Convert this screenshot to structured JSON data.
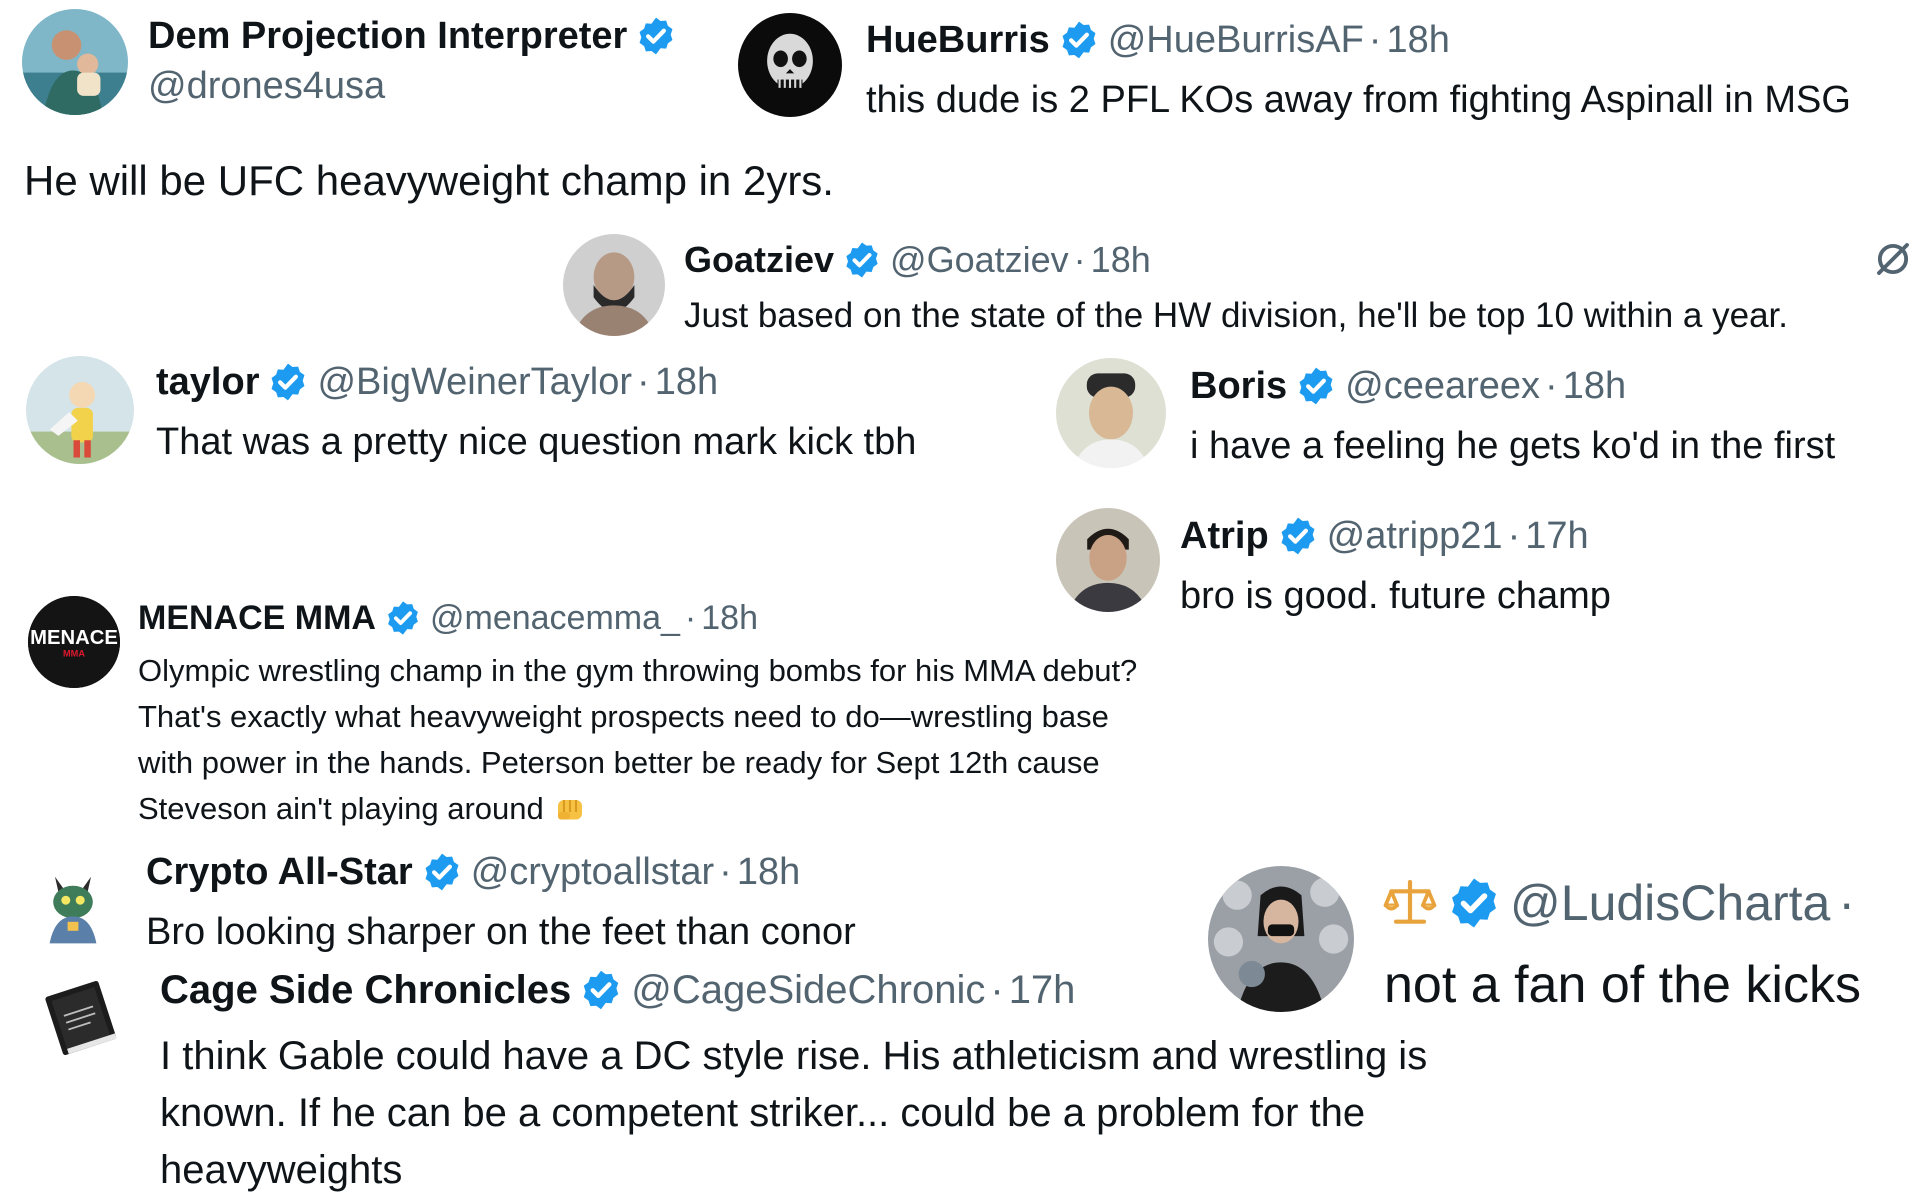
{
  "colors": {
    "verified_badge": "#1d9bf0",
    "text_primary": "#0f1419",
    "text_secondary": "#536471",
    "background": "#ffffff"
  },
  "posts": [
    {
      "id": "p1",
      "display_name": "Dem Projection Interpreter",
      "verified": true,
      "handle": "@drones4usa",
      "text": "He will be UFC heavyweight champ in 2yrs.",
      "avatar_icon": "person-holding-child-avatar"
    },
    {
      "id": "p2",
      "display_name": "HueBurris",
      "verified": true,
      "handle": "@HueBurrisAF",
      "separator": "·",
      "time": "18h",
      "text": "this dude is 2 PFL KOs away from fighting Aspinall in MSG",
      "avatar_icon": "skull-avatar"
    },
    {
      "id": "p3",
      "display_name": "Goatziev",
      "verified": true,
      "handle": "@Goatziev",
      "separator": "·",
      "time": "18h",
      "text": "Just based on the state of the HW division, he'll be top 10 within a year.",
      "avatar_icon": "bearded-fighter-avatar",
      "extra_icon": "grok-slash-icon"
    },
    {
      "id": "p4",
      "display_name": "taylor",
      "verified": true,
      "handle": "@BigWeinerTaylor",
      "separator": "·",
      "time": "18h",
      "text": "That was a pretty nice question mark kick tbh",
      "avatar_icon": "anime-hero-avatar"
    },
    {
      "id": "p5",
      "display_name": "Boris",
      "verified": true,
      "handle": "@ceeareex",
      "separator": "·",
      "time": "18h",
      "text": "i have a feeling he gets ko'd in the first",
      "avatar_icon": "selfie-avatar"
    },
    {
      "id": "p6",
      "display_name": "Atrip",
      "verified": true,
      "handle": "@atripp21",
      "separator": "·",
      "time": "17h",
      "text": "bro is good. future champ",
      "avatar_icon": "man-portrait-avatar"
    },
    {
      "id": "p7",
      "display_name": "MENACE MMA",
      "verified": true,
      "handle": "@menacemma_",
      "separator": "·",
      "time": "18h",
      "text_lines": [
        "Olympic wrestling champ in the gym throwing bombs for his MMA debut?",
        "That's exactly what heavyweight prospects need to do—wrestling base",
        "with power in the hands. Peterson better be ready for Sept 12th cause",
        "Steveson ain't playing around"
      ],
      "emoji_icon": "fist-emoji-icon",
      "avatar_icon": "menace-logo-avatar",
      "avatar_logo_text": "MENACE",
      "avatar_logo_subtext": "MMA"
    },
    {
      "id": "p8",
      "display_name": "Crypto All-Star",
      "verified": true,
      "handle": "@cryptoallstar",
      "separator": "·",
      "time": "18h",
      "text": "Bro looking sharper on the feet than conor",
      "avatar_icon": "cartoon-creature-avatar"
    },
    {
      "id": "p9",
      "display_name": "Cage Side Chronicles",
      "verified": true,
      "handle": "@CageSideChronic",
      "separator": "·",
      "time": "17h",
      "text_lines": [
        "I think Gable could have a DC style rise. His athleticism and wrestling is",
        "known. If he can be a competent striker... could be a problem for the",
        "heavyweights"
      ],
      "avatar_icon": "book-logo-avatar"
    },
    {
      "id": "p10",
      "name_icon": "scales-emoji-icon",
      "verified": true,
      "handle": "@LudisCharta",
      "separator": "·",
      "text": "not a fan of the kicks",
      "avatar_icon": "woman-masked-avatar"
    }
  ]
}
